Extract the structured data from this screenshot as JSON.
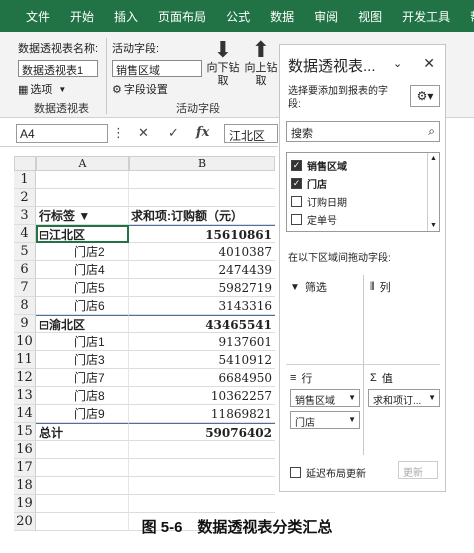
{
  "ribbon_tabs": [
    "文件",
    "开始",
    "插入",
    "页面布局",
    "公式",
    "数据",
    "审阅",
    "视图",
    "开发工具",
    "帮助"
  ],
  "ribbon": {
    "pivot_name_label": "数据透视表名称:",
    "pivot_name_value": "数据透视表1",
    "options_label": "选项",
    "group_pivot": "数据透视表",
    "active_field_label": "活动字段:",
    "active_field_value": "销售区域",
    "field_settings_label": "字段设置",
    "drill_down_label": "向下钻取",
    "drill_up_label": "向上钻取",
    "group_active_field": "活动字段"
  },
  "formula_bar": {
    "name_box": "A4",
    "cancel_icon": "✕",
    "enter_icon": "✓",
    "fx_label": "fx",
    "value": "江北区"
  },
  "sheet": {
    "columns": [
      "A",
      "B"
    ],
    "rows": [
      {
        "n": "1",
        "a": "",
        "b": ""
      },
      {
        "n": "2",
        "a": "",
        "b": ""
      },
      {
        "n": "3",
        "a": "行标签 ▼",
        "b": "求和项:订购额（元）"
      },
      {
        "n": "4",
        "a": "⊟江北区",
        "b": "15610861"
      },
      {
        "n": "5",
        "a": "门店2",
        "b": "4010387"
      },
      {
        "n": "6",
        "a": "门店4",
        "b": "2474439"
      },
      {
        "n": "7",
        "a": "门店5",
        "b": "5982719"
      },
      {
        "n": "8",
        "a": "门店6",
        "b": "3143316"
      },
      {
        "n": "9",
        "a": "⊟渝北区",
        "b": "43465541"
      },
      {
        "n": "10",
        "a": "门店1",
        "b": "9137601"
      },
      {
        "n": "11",
        "a": "门店3",
        "b": "5410912"
      },
      {
        "n": "12",
        "a": "门店7",
        "b": "6684950"
      },
      {
        "n": "13",
        "a": "门店8",
        "b": "10362257"
      },
      {
        "n": "14",
        "a": "门店9",
        "b": "11869821"
      },
      {
        "n": "15",
        "a": "总计",
        "b": "59076402"
      },
      {
        "n": "16",
        "a": "",
        "b": ""
      },
      {
        "n": "17",
        "a": "",
        "b": ""
      },
      {
        "n": "18",
        "a": "",
        "b": ""
      },
      {
        "n": "19",
        "a": "",
        "b": ""
      },
      {
        "n": "20",
        "a": "",
        "b": ""
      }
    ]
  },
  "pane": {
    "title": "数据透视表...",
    "subtitle": "选择要添加到报表的字段:",
    "search_placeholder": "搜索",
    "fields": [
      {
        "label": "销售区域",
        "checked": true
      },
      {
        "label": "门店",
        "checked": true
      },
      {
        "label": "订购日期",
        "checked": false
      },
      {
        "label": "定单号",
        "checked": false
      }
    ],
    "areas_label": "在以下区域间拖动字段:",
    "filter_label": "筛选",
    "columns_label": "列",
    "rows_label": "行",
    "values_label": "值",
    "row_fields": [
      "销售区域",
      "门店"
    ],
    "value_fields": [
      "求和项订..."
    ],
    "defer_label": "延迟布局更新",
    "update_label": "更新"
  },
  "caption": "图 5-6　数据透视表分类汇总"
}
